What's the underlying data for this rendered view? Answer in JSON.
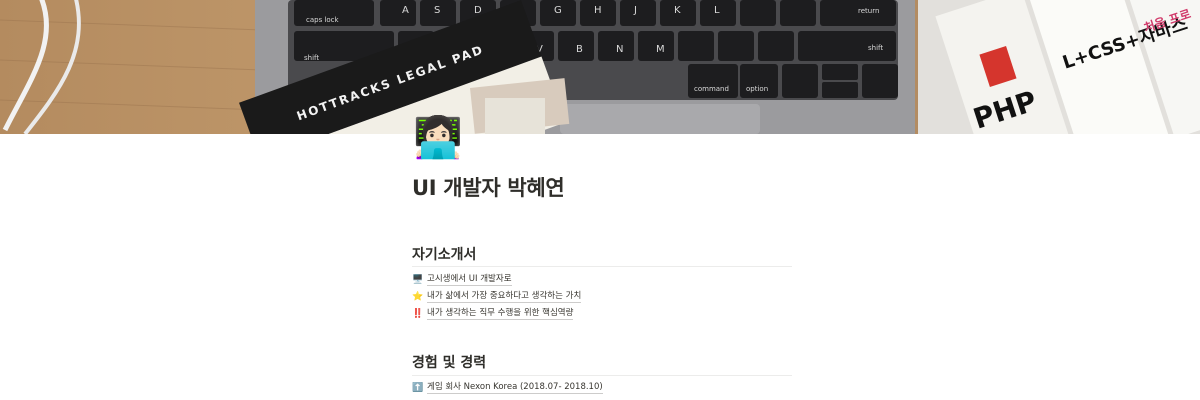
{
  "cover": {
    "image": "laptop-keyboard-legal-pad-books"
  },
  "page": {
    "icon": "👩🏻‍💻",
    "title": "UI 개발자 박혜연"
  },
  "sections": [
    {
      "heading": "자기소개서",
      "items": [
        {
          "icon": "desktop-computer-icon",
          "glyph": "🖥️",
          "label": "고시생에서 UI 개발자로"
        },
        {
          "icon": "star-icon",
          "glyph": "⭐",
          "label": "내가 삶에서 가장 중요하다고 생각하는 가치"
        },
        {
          "icon": "double-exclamation-icon",
          "glyph": "‼️",
          "label": "내가 생각하는 직무 수행을 위한 핵심역량"
        }
      ]
    },
    {
      "heading": "경험 및 경력",
      "items": [
        {
          "icon": "up-arrow-icon",
          "glyph": "⬆️",
          "label": "게임 회사 Nexon Korea (2018.07- 2018.10)"
        }
      ]
    }
  ],
  "cover_text": {
    "keys": [
      "caps lock",
      "shift",
      "command",
      "option",
      "return",
      "shift"
    ],
    "pad": "HOTTRACKS LEGAL PAD",
    "books": [
      "PHP",
      "L+CSS+자바스",
      "처음 프로"
    ]
  }
}
